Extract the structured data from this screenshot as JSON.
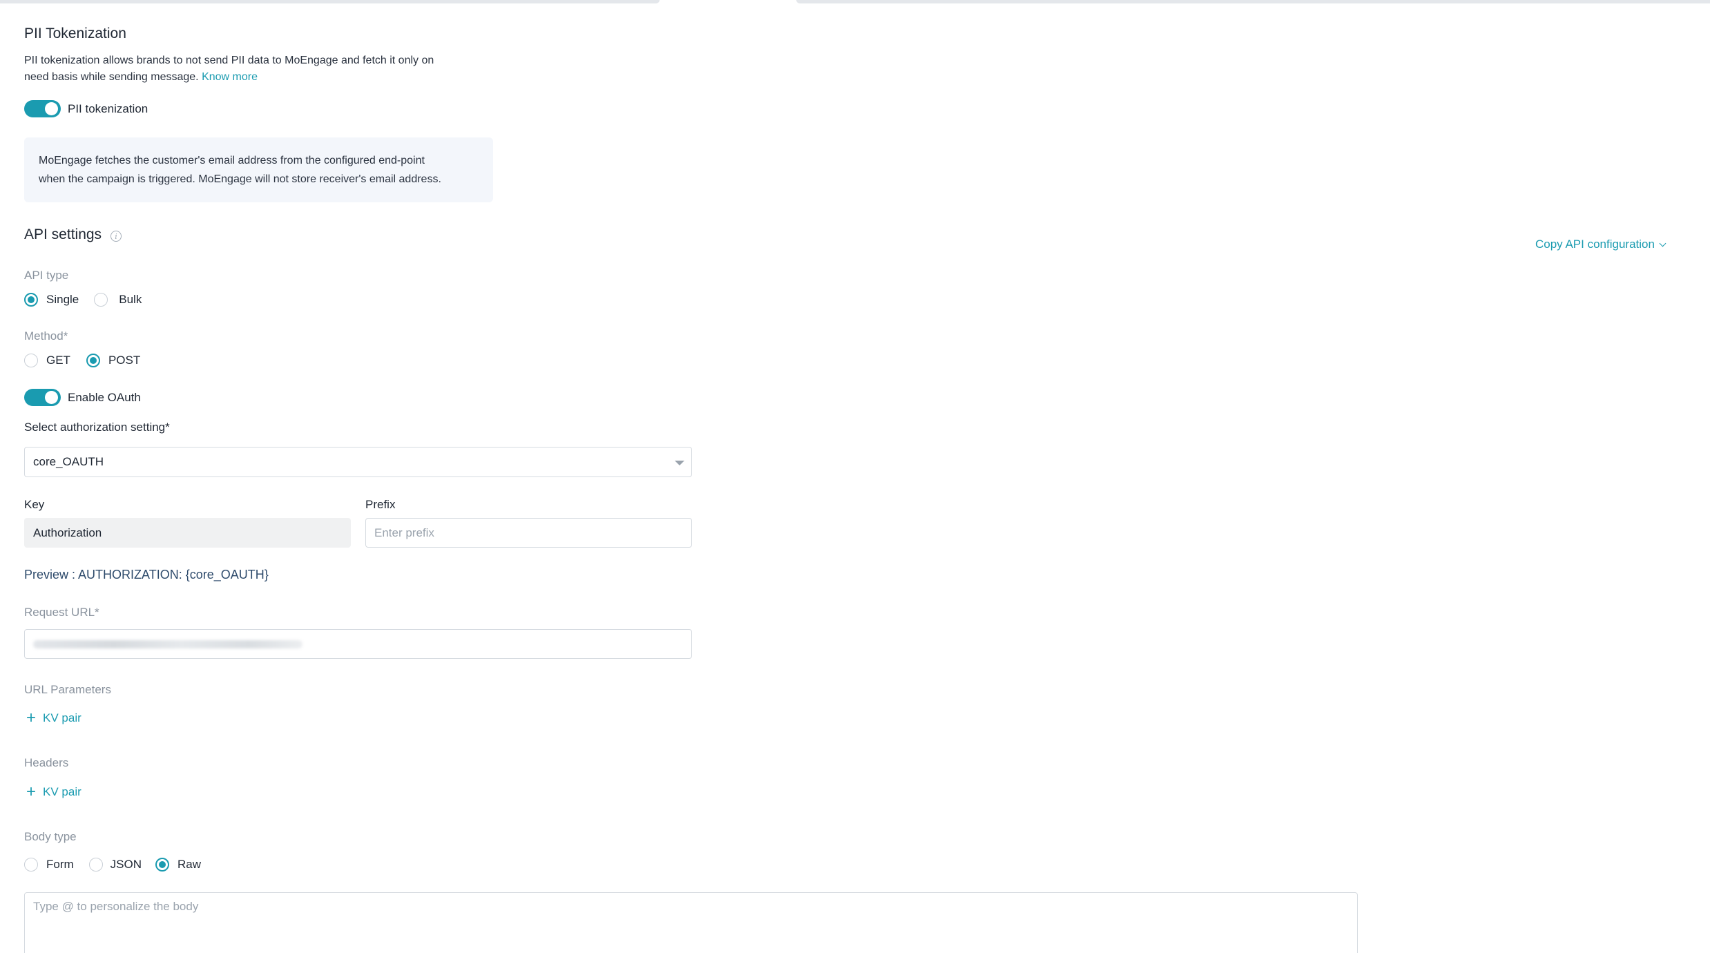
{
  "pii": {
    "title": "PII Tokenization",
    "description_line1": "PII tokenization allows brands to not send PII data to MoEngage and fetch it only on",
    "description_line2": "need basis while sending message.",
    "know_more": "Know more",
    "toggle_label": "PII tokenization",
    "toggle_on": true,
    "info_line1": "MoEngage fetches the customer's email address from the configured end-point",
    "info_line2": "when the campaign is triggered. MoEngage will not store receiver's email address."
  },
  "api_settings": {
    "title": "API settings",
    "copy_config": "Copy API configuration",
    "api_type": {
      "label": "API type",
      "options": [
        "Single",
        "Bulk"
      ],
      "selected": "Single"
    },
    "method": {
      "label": "Method*",
      "options": [
        "GET",
        "POST"
      ],
      "selected": "POST"
    },
    "oauth": {
      "toggle_label": "Enable OAuth",
      "toggle_on": true
    },
    "auth_setting": {
      "label": "Select authorization setting*",
      "value": "core_OAUTH"
    },
    "key": {
      "label": "Key",
      "value": "Authorization"
    },
    "prefix": {
      "label": "Prefix",
      "placeholder": "Enter prefix"
    },
    "preview": "Preview : AUTHORIZATION: {core_OAUTH}",
    "request_url": {
      "label": "Request URL*"
    },
    "url_params": {
      "label": "URL Parameters",
      "add_label": "KV pair"
    },
    "headers": {
      "label": "Headers",
      "add_label": "KV pair"
    },
    "body_type": {
      "label": "Body type",
      "options": [
        "Form",
        "JSON",
        "Raw"
      ],
      "selected": "Raw"
    },
    "body": {
      "placeholder": "Type @ to personalize the body"
    }
  },
  "colors": {
    "accent": "#1a9bb0",
    "info_bg": "#f3f6fb",
    "muted_label": "#8a939e"
  }
}
